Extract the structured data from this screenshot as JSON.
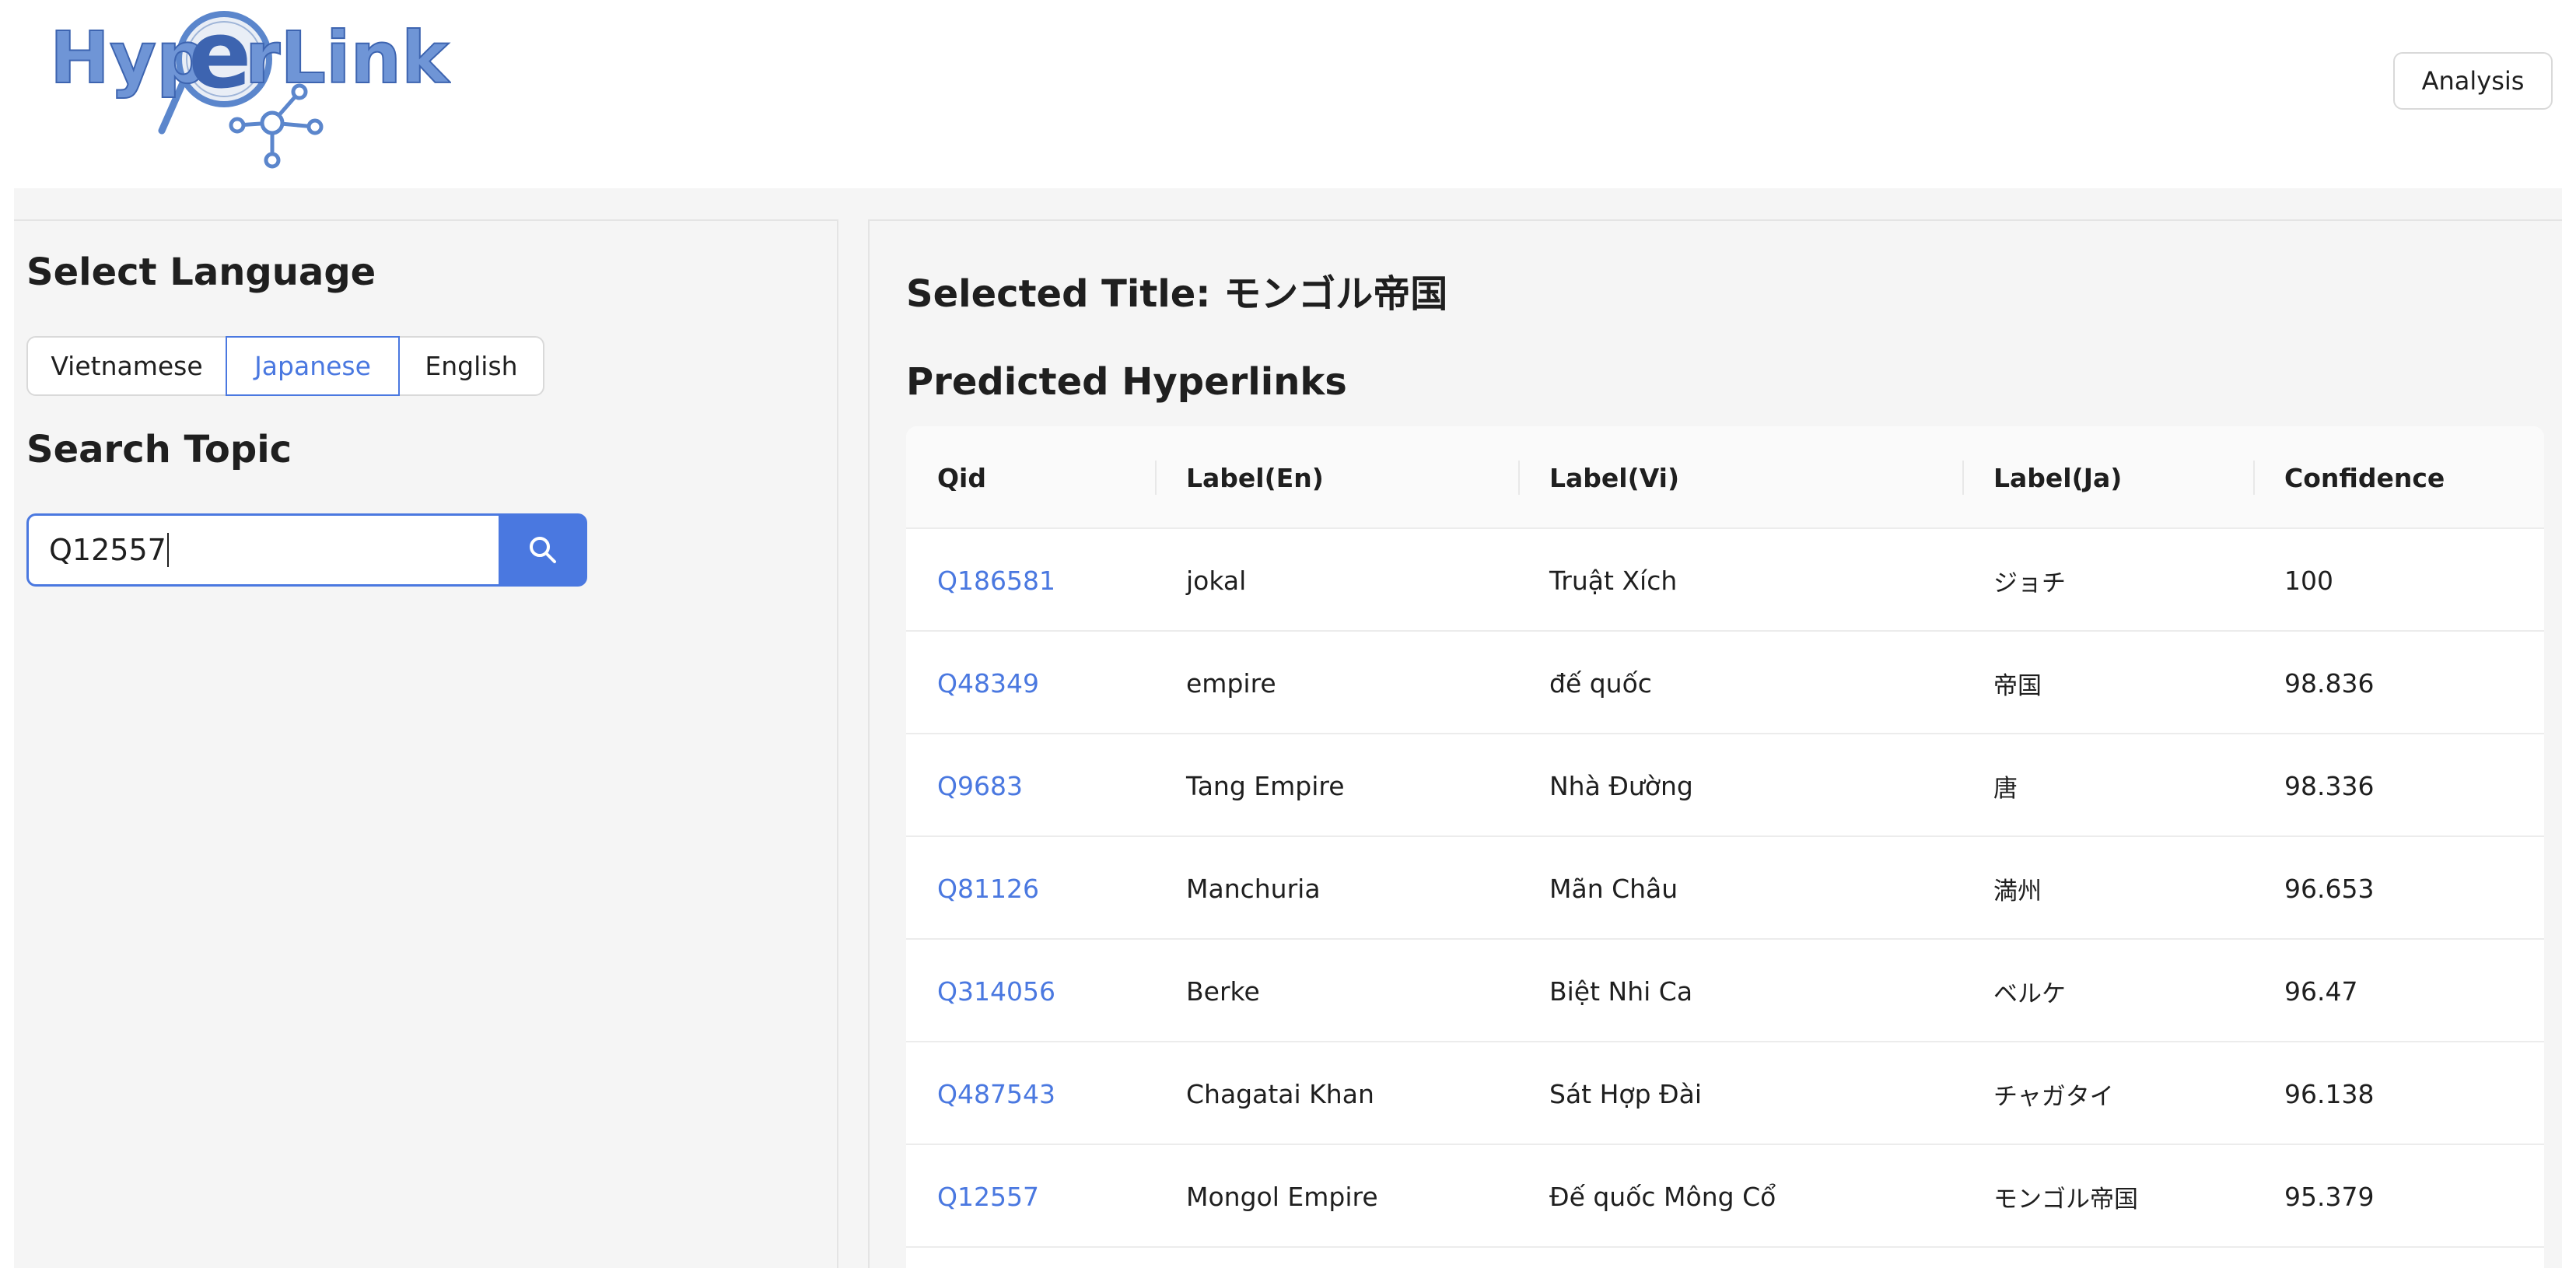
{
  "header": {
    "logo_text": "HyperLink",
    "analysis_label": "Analysis"
  },
  "left": {
    "select_language_heading": "Select Language",
    "languages": [
      {
        "label": "Vietnamese",
        "active": false
      },
      {
        "label": "Japanese",
        "active": true
      },
      {
        "label": "English",
        "active": false
      }
    ],
    "search_heading": "Search Topic",
    "search_value": "Q12557",
    "search_icon": "search-icon"
  },
  "right": {
    "selected_title": "Selected Title: モンゴル帝国",
    "predicted_heading": "Predicted Hyperlinks",
    "columns": [
      "Qid",
      "Label(En)",
      "Label(Vi)",
      "Label(Ja)",
      "Confidence"
    ],
    "rows": [
      {
        "qid": "Q186581",
        "en": "jokal",
        "vi": "Truật Xích",
        "ja": "ジョチ",
        "confidence": "100"
      },
      {
        "qid": "Q48349",
        "en": "empire",
        "vi": "đế quốc",
        "ja": "帝国",
        "confidence": "98.836"
      },
      {
        "qid": "Q9683",
        "en": "Tang Empire",
        "vi": "Nhà Đường",
        "ja": "唐",
        "confidence": "98.336"
      },
      {
        "qid": "Q81126",
        "en": "Manchuria",
        "vi": "Mãn Châu",
        "ja": "満州",
        "confidence": "96.653"
      },
      {
        "qid": "Q314056",
        "en": "Berke",
        "vi": "Biệt Nhi Ca",
        "ja": "ベルケ",
        "confidence": "96.47"
      },
      {
        "qid": "Q487543",
        "en": "Chagatai Khan",
        "vi": "Sát Hợp Đài",
        "ja": "チャガタイ",
        "confidence": "96.138"
      },
      {
        "qid": "Q12557",
        "en": "Mongol Empire",
        "vi": "Đế quốc Mông Cổ",
        "ja": "モンゴル帝国",
        "confidence": "95.379"
      }
    ]
  },
  "colors": {
    "accent": "#4a78e0",
    "panel_bg": "#f5f5f5",
    "logo_blue": "#5b86cc"
  }
}
